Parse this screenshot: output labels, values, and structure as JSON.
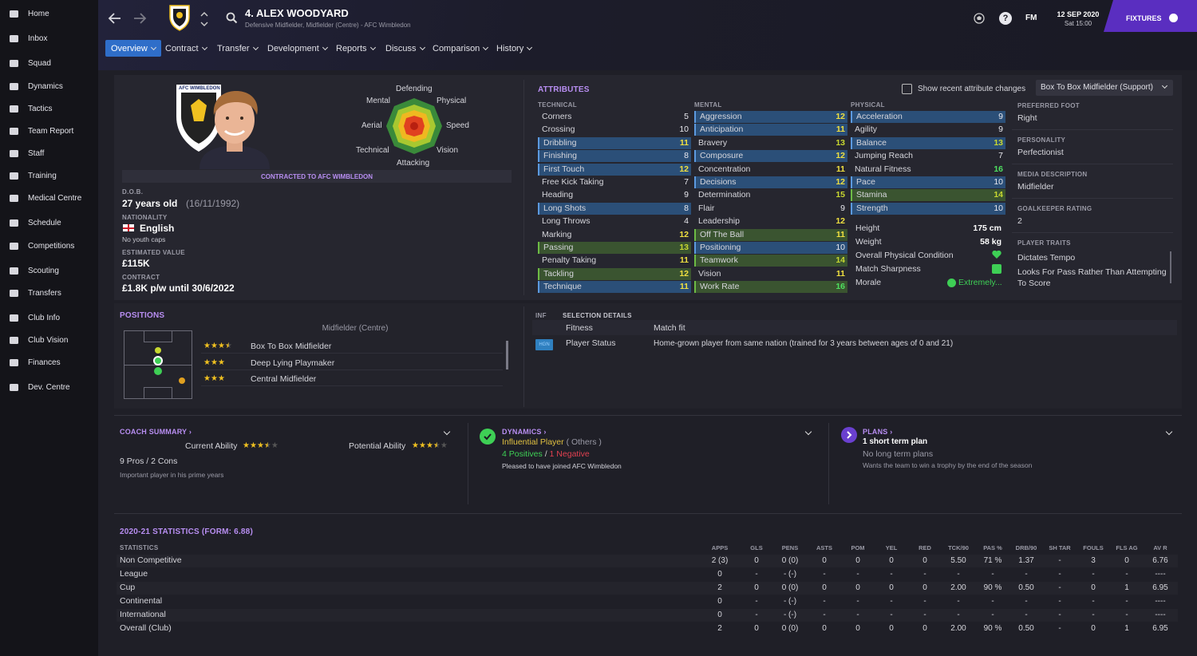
{
  "sidebar": {
    "items": [
      {
        "label": "Home",
        "icon": "home-icon"
      },
      {
        "label": "Inbox",
        "icon": "inbox-icon"
      },
      {
        "label": "Squad",
        "icon": "squad-icon"
      },
      {
        "label": "Dynamics",
        "icon": "dynamics-icon"
      },
      {
        "label": "Tactics",
        "icon": "tactics-icon"
      },
      {
        "label": "Team Report",
        "icon": "report-icon"
      },
      {
        "label": "Staff",
        "icon": "staff-icon"
      },
      {
        "label": "Training",
        "icon": "training-icon"
      },
      {
        "label": "Medical Centre",
        "icon": "medical-icon"
      },
      {
        "label": "Schedule",
        "icon": "calendar-icon"
      },
      {
        "label": "Competitions",
        "icon": "trophy-icon"
      },
      {
        "label": "Scouting",
        "icon": "search-icon"
      },
      {
        "label": "Transfers",
        "icon": "transfer-icon"
      },
      {
        "label": "Club Info",
        "icon": "shield-icon"
      },
      {
        "label": "Club Vision",
        "icon": "vision-icon"
      },
      {
        "label": "Finances",
        "icon": "finances-icon"
      },
      {
        "label": "Dev. Centre",
        "icon": "dev-centre-icon"
      }
    ]
  },
  "header": {
    "player_title": "4. ALEX WOODYARD",
    "player_subtitle": "Defensive Midfielder, Midfielder (Centre) - AFC Wimbledon",
    "fm_label": "FM",
    "date": "12 SEP 2020",
    "time": "Sat 15:00",
    "fixtures_label": "FIXTURES",
    "tabs": [
      {
        "label": "Overview",
        "active": true
      },
      {
        "label": "Contract"
      },
      {
        "label": "Transfer"
      },
      {
        "label": "Development"
      },
      {
        "label": "Reports"
      },
      {
        "label": "Discuss"
      },
      {
        "label": "Comparison"
      },
      {
        "label": "History"
      }
    ]
  },
  "profile": {
    "badge_text": "AFC WIMBLEDON",
    "contracted_to": "CONTRACTED TO AFC WIMBLEDON",
    "dob_label": "D.O.B.",
    "age": "27 years old",
    "dob": "(16/11/1992)",
    "nationality_label": "NATIONALITY",
    "nationality": "English",
    "youth_caps": "No youth caps",
    "value_label": "ESTIMATED VALUE",
    "value": "£115K",
    "contract_label": "CONTRACT",
    "contract": "£1.8K p/w until 30/6/2022",
    "radar": {
      "defending": "Defending",
      "physical": "Physical",
      "speed": "Speed",
      "vision": "Vision",
      "attacking": "Attacking",
      "technical": "Technical",
      "aerial": "Aerial",
      "mental": "Mental"
    }
  },
  "attributes": {
    "title": "ATTRIBUTES",
    "show_changes_label": "Show recent attribute changes",
    "role_select": "Box To Box Midfielder (Support)",
    "technical_label": "TECHNICAL",
    "mental_label": "MENTAL",
    "physical_label": "PHYSICAL",
    "technical": [
      {
        "name": "Corners",
        "value": "5",
        "hl": ""
      },
      {
        "name": "Crossing",
        "value": "10",
        "hl": ""
      },
      {
        "name": "Dribbling",
        "value": "11",
        "hl": "blue"
      },
      {
        "name": "Finishing",
        "value": "8",
        "hl": "blue"
      },
      {
        "name": "First Touch",
        "value": "12",
        "hl": "blue"
      },
      {
        "name": "Free Kick Taking",
        "value": "7",
        "hl": ""
      },
      {
        "name": "Heading",
        "value": "9",
        "hl": ""
      },
      {
        "name": "Long Shots",
        "value": "8",
        "hl": "blue"
      },
      {
        "name": "Long Throws",
        "value": "4",
        "hl": ""
      },
      {
        "name": "Marking",
        "value": "12",
        "hl": ""
      },
      {
        "name": "Passing",
        "value": "13",
        "hl": "green"
      },
      {
        "name": "Penalty Taking",
        "value": "11",
        "hl": ""
      },
      {
        "name": "Tackling",
        "value": "12",
        "hl": "green"
      },
      {
        "name": "Technique",
        "value": "11",
        "hl": "blue"
      }
    ],
    "mental": [
      {
        "name": "Aggression",
        "value": "12",
        "hl": "blue"
      },
      {
        "name": "Anticipation",
        "value": "11",
        "hl": "blue"
      },
      {
        "name": "Bravery",
        "value": "13",
        "hl": ""
      },
      {
        "name": "Composure",
        "value": "12",
        "hl": "blue"
      },
      {
        "name": "Concentration",
        "value": "11",
        "hl": ""
      },
      {
        "name": "Decisions",
        "value": "12",
        "hl": "blue"
      },
      {
        "name": "Determination",
        "value": "15",
        "hl": ""
      },
      {
        "name": "Flair",
        "value": "9",
        "hl": ""
      },
      {
        "name": "Leadership",
        "value": "12",
        "hl": ""
      },
      {
        "name": "Off The Ball",
        "value": "11",
        "hl": "green"
      },
      {
        "name": "Positioning",
        "value": "10",
        "hl": "blue"
      },
      {
        "name": "Teamwork",
        "value": "14",
        "hl": "green"
      },
      {
        "name": "Vision",
        "value": "11",
        "hl": ""
      },
      {
        "name": "Work Rate",
        "value": "16",
        "hl": "green"
      }
    ],
    "physical": [
      {
        "name": "Acceleration",
        "value": "9",
        "hl": "blue"
      },
      {
        "name": "Agility",
        "value": "9",
        "hl": ""
      },
      {
        "name": "Balance",
        "value": "13",
        "hl": "blue"
      },
      {
        "name": "Jumping Reach",
        "value": "7",
        "hl": ""
      },
      {
        "name": "Natural Fitness",
        "value": "16",
        "hl": ""
      },
      {
        "name": "Pace",
        "value": "10",
        "hl": "blue"
      },
      {
        "name": "Stamina",
        "value": "14",
        "hl": "green"
      },
      {
        "name": "Strength",
        "value": "10",
        "hl": "blue"
      }
    ],
    "height_label": "Height",
    "height": "175 cm",
    "weight_label": "Weight",
    "weight": "58 kg",
    "condition_label": "Overall Physical Condition",
    "sharpness_label": "Match Sharpness",
    "morale_label": "Morale",
    "morale": "Extremely..."
  },
  "info": {
    "preferred_foot_label": "PREFERRED FOOT",
    "preferred_foot": "Right",
    "personality_label": "PERSONALITY",
    "personality": "Perfectionist",
    "media_label": "MEDIA DESCRIPTION",
    "media": "Midfielder",
    "gk_label": "GOALKEEPER RATING",
    "gk": "2",
    "traits_label": "PLAYER TRAITS",
    "trait1": "Dictates Tempo",
    "trait2": "Looks For Pass Rather Than Attempting To Score"
  },
  "positions": {
    "title": "POSITIONS",
    "main": "Midfielder (Centre)",
    "roles": [
      {
        "name": "Box To Box Midfielder",
        "stars": 3.5
      },
      {
        "name": "Deep Lying Playmaker",
        "stars": 3
      },
      {
        "name": "Central Midfielder",
        "stars": 3
      }
    ]
  },
  "selection": {
    "inf_label": "INF",
    "title": "SELECTION DETAILS",
    "fitness_label": "Fitness",
    "fitness": "Match fit",
    "status_badge": "HGN",
    "status_label": "Player Status",
    "status": "Home-grown player from same nation (trained for 3 years between ages of 0 and 21)"
  },
  "coach": {
    "title": "COACH SUMMARY",
    "ca_label": "Current Ability",
    "ca_stars": 3.5,
    "pa_label": "Potential Ability",
    "pa_stars": 3.5,
    "pros_cons": "9 Pros / 2 Cons",
    "note": "Important player in his prime years"
  },
  "dynamics": {
    "title": "DYNAMICS",
    "status": "Influential Player",
    "group": "( Others )",
    "positives": "4 Positives",
    "sep": "/",
    "negatives": "1 Negative",
    "note": "Pleased to have joined AFC Wimbledon"
  },
  "plans": {
    "title": "PLANS",
    "short": "1 short term plan",
    "long": "No long term plans",
    "note": "Wants the team to win a trophy by the end of the season"
  },
  "stats": {
    "title": "2020-21 STATISTICS (FORM: 6.88)",
    "col_label": "STATISTICS",
    "headers": [
      "APPS",
      "GLS",
      "PENS",
      "ASTS",
      "POM",
      "YEL",
      "RED",
      "TCK/90",
      "PAS %",
      "DRB/90",
      "SH TAR",
      "FOULS",
      "FLS AG",
      "AV R"
    ],
    "rows": [
      {
        "name": "Non Competitive",
        "cells": [
          "2 (3)",
          "0",
          "0 (0)",
          "0",
          "0",
          "0",
          "0",
          "5.50",
          "71 %",
          "1.37",
          "-",
          "3",
          "0",
          "6.76"
        ]
      },
      {
        "name": "League",
        "cells": [
          "0",
          "-",
          "- (-)",
          "-",
          "-",
          "-",
          "-",
          "-",
          "-",
          "-",
          "-",
          "-",
          "-",
          "----"
        ]
      },
      {
        "name": "Cup",
        "cells": [
          "2",
          "0",
          "0 (0)",
          "0",
          "0",
          "0",
          "0",
          "2.00",
          "90 %",
          "0.50",
          "-",
          "0",
          "1",
          "6.95"
        ]
      },
      {
        "name": "Continental",
        "cells": [
          "0",
          "-",
          "- (-)",
          "-",
          "-",
          "-",
          "-",
          "-",
          "-",
          "-",
          "-",
          "-",
          "-",
          "----"
        ]
      },
      {
        "name": "International",
        "cells": [
          "0",
          "-",
          "- (-)",
          "-",
          "-",
          "-",
          "-",
          "-",
          "-",
          "-",
          "-",
          "-",
          "-",
          "----"
        ]
      },
      {
        "name": "Overall (Club)",
        "cells": [
          "2",
          "0",
          "0 (0)",
          "0",
          "0",
          "0",
          "0",
          "2.00",
          "90 %",
          "0.50",
          "-",
          "0",
          "1",
          "6.95"
        ]
      }
    ]
  },
  "colors": {
    "accent": "#2f6ec9",
    "purple": "#5a2ec0",
    "section": "#b88ef2",
    "green": "#3ecf55",
    "yellow": "#f0c020"
  }
}
